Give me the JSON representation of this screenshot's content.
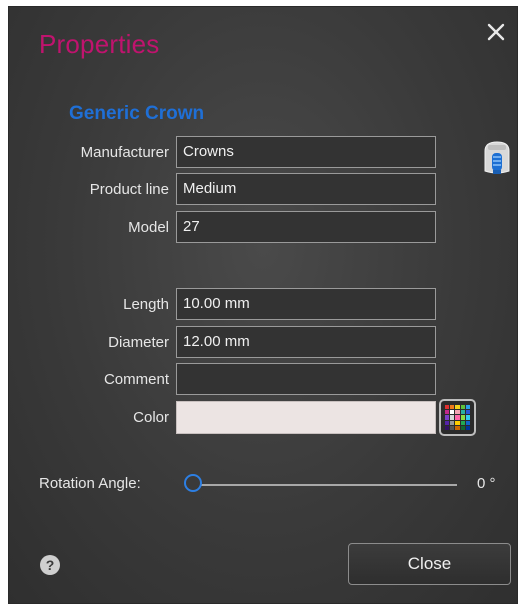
{
  "dialog": {
    "title": "Properties",
    "close_icon": "close-icon",
    "subtitle": "Generic Crown"
  },
  "fields": {
    "manufacturer": {
      "label": "Manufacturer",
      "value": "Crowns"
    },
    "product_line": {
      "label": "Product line",
      "value": "Medium"
    },
    "model": {
      "label": "Model",
      "value": "27"
    },
    "length": {
      "label": "Length",
      "value": "10.00 mm"
    },
    "diameter": {
      "label": "Diameter",
      "value": "12.00 mm"
    },
    "comment": {
      "label": "Comment",
      "value": ""
    },
    "color": {
      "label": "Color",
      "value": "#ece4e3"
    }
  },
  "rotation": {
    "label": "Rotation Angle:",
    "value_text": "0 °",
    "slider_fraction": 0
  },
  "footer": {
    "help_icon": "help-icon",
    "help_glyph": "?",
    "close_label": "Close"
  },
  "colors": {
    "title": "#c0136e",
    "subtitle": "#1f6fd6",
    "slider_thumb": "#2d7fe3"
  },
  "icons": [
    "crown-icon",
    "color-palette-icon",
    "close-icon",
    "help-icon"
  ]
}
